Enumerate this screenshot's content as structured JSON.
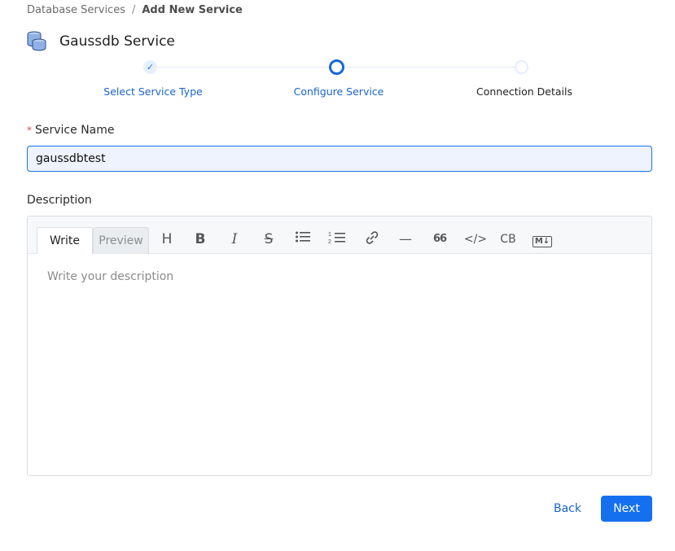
{
  "breadcrumb": {
    "items": [
      "Database Services",
      "Add New Service"
    ],
    "separator": "/"
  },
  "header": {
    "title": "Gaussdb Service",
    "icon": "database-stack-icon"
  },
  "stepper": {
    "steps": [
      {
        "label": "Select Service Type",
        "state": "completed"
      },
      {
        "label": "Configure Service",
        "state": "active"
      },
      {
        "label": "Connection Details",
        "state": "pending"
      }
    ],
    "completed_glyph": "✓"
  },
  "form": {
    "service_name_label": "Service Name",
    "service_name_required": "*",
    "service_name_value": "gaussdbtest",
    "description_label": "Description"
  },
  "editor": {
    "tabs": {
      "write": "Write",
      "preview": "Preview"
    },
    "placeholder": "Write your description",
    "tools": [
      {
        "name": "heading-icon",
        "glyph": "H"
      },
      {
        "name": "bold-icon",
        "glyph": "B"
      },
      {
        "name": "italic-icon",
        "glyph": "I"
      },
      {
        "name": "strikethrough-icon",
        "glyph": "S"
      },
      {
        "name": "bullet-list-icon",
        "glyph": ""
      },
      {
        "name": "numbered-list-icon",
        "glyph": ""
      },
      {
        "name": "link-icon",
        "glyph": ""
      },
      {
        "name": "horizontal-rule-icon",
        "glyph": "—"
      },
      {
        "name": "quote-icon",
        "glyph": "66"
      },
      {
        "name": "code-icon",
        "glyph": "</>"
      },
      {
        "name": "code-block-icon",
        "glyph": "CB"
      },
      {
        "name": "markdown-icon",
        "glyph": "M↓"
      }
    ]
  },
  "actions": {
    "back_label": "Back",
    "next_label": "Next"
  },
  "colors": {
    "accent": "#1570ef",
    "link": "#1a64c8",
    "input_bg": "#eef3fd",
    "required": "#e5484d"
  }
}
